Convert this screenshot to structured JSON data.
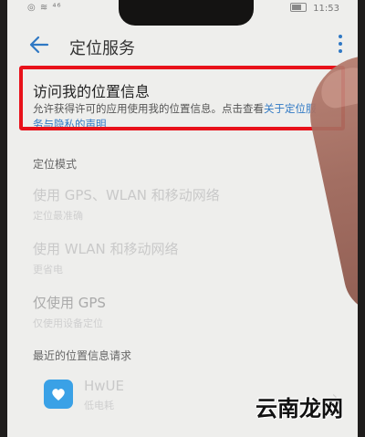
{
  "status_bar": {
    "left": "◎ ≋ ⁴⁶",
    "time": "11:53"
  },
  "header": {
    "title": "定位服务"
  },
  "access": {
    "title": "访问我的位置信息",
    "desc_plain": "允许获得许可的应用使用我的位置信息。点击查看",
    "desc_link": "关于定位服务与隐私的声明"
  },
  "location_mode": {
    "header": "定位模式",
    "options": [
      {
        "title": "使用 GPS、WLAN 和移动网络",
        "sub": "定位最准确"
      },
      {
        "title": "使用 WLAN 和移动网络",
        "sub": "更省电"
      },
      {
        "title": "仅使用 GPS",
        "sub": "仅使用设备定位"
      }
    ]
  },
  "recent_requests": {
    "header": "最近的位置信息请求",
    "apps": [
      {
        "name": "HwUE",
        "usage": "低电耗"
      }
    ]
  },
  "watermark": "云南龙网",
  "colors": {
    "accent": "#2f78c4",
    "highlight_border": "#e8111a"
  }
}
